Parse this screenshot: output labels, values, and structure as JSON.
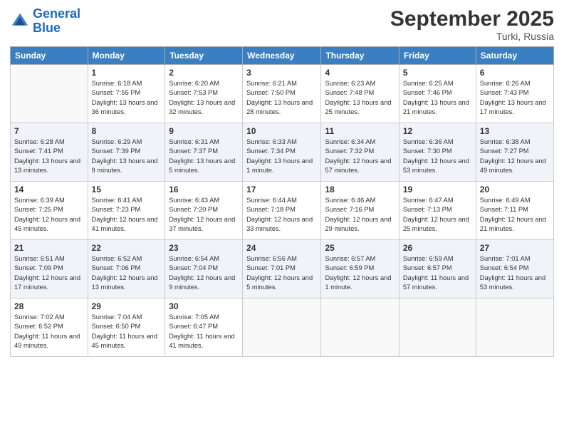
{
  "header": {
    "logo_line1": "General",
    "logo_line2": "Blue",
    "month": "September 2025",
    "location": "Turki, Russia"
  },
  "weekdays": [
    "Sunday",
    "Monday",
    "Tuesday",
    "Wednesday",
    "Thursday",
    "Friday",
    "Saturday"
  ],
  "weeks": [
    [
      {
        "day": "",
        "sunrise": "",
        "sunset": "",
        "daylight": ""
      },
      {
        "day": "1",
        "sunrise": "Sunrise: 6:18 AM",
        "sunset": "Sunset: 7:55 PM",
        "daylight": "Daylight: 13 hours and 36 minutes."
      },
      {
        "day": "2",
        "sunrise": "Sunrise: 6:20 AM",
        "sunset": "Sunset: 7:53 PM",
        "daylight": "Daylight: 13 hours and 32 minutes."
      },
      {
        "day": "3",
        "sunrise": "Sunrise: 6:21 AM",
        "sunset": "Sunset: 7:50 PM",
        "daylight": "Daylight: 13 hours and 28 minutes."
      },
      {
        "day": "4",
        "sunrise": "Sunrise: 6:23 AM",
        "sunset": "Sunset: 7:48 PM",
        "daylight": "Daylight: 13 hours and 25 minutes."
      },
      {
        "day": "5",
        "sunrise": "Sunrise: 6:25 AM",
        "sunset": "Sunset: 7:46 PM",
        "daylight": "Daylight: 13 hours and 21 minutes."
      },
      {
        "day": "6",
        "sunrise": "Sunrise: 6:26 AM",
        "sunset": "Sunset: 7:43 PM",
        "daylight": "Daylight: 13 hours and 17 minutes."
      }
    ],
    [
      {
        "day": "7",
        "sunrise": "Sunrise: 6:28 AM",
        "sunset": "Sunset: 7:41 PM",
        "daylight": "Daylight: 13 hours and 13 minutes."
      },
      {
        "day": "8",
        "sunrise": "Sunrise: 6:29 AM",
        "sunset": "Sunset: 7:39 PM",
        "daylight": "Daylight: 13 hours and 9 minutes."
      },
      {
        "day": "9",
        "sunrise": "Sunrise: 6:31 AM",
        "sunset": "Sunset: 7:37 PM",
        "daylight": "Daylight: 13 hours and 5 minutes."
      },
      {
        "day": "10",
        "sunrise": "Sunrise: 6:33 AM",
        "sunset": "Sunset: 7:34 PM",
        "daylight": "Daylight: 13 hours and 1 minute."
      },
      {
        "day": "11",
        "sunrise": "Sunrise: 6:34 AM",
        "sunset": "Sunset: 7:32 PM",
        "daylight": "Daylight: 12 hours and 57 minutes."
      },
      {
        "day": "12",
        "sunrise": "Sunrise: 6:36 AM",
        "sunset": "Sunset: 7:30 PM",
        "daylight": "Daylight: 12 hours and 53 minutes."
      },
      {
        "day": "13",
        "sunrise": "Sunrise: 6:38 AM",
        "sunset": "Sunset: 7:27 PM",
        "daylight": "Daylight: 12 hours and 49 minutes."
      }
    ],
    [
      {
        "day": "14",
        "sunrise": "Sunrise: 6:39 AM",
        "sunset": "Sunset: 7:25 PM",
        "daylight": "Daylight: 12 hours and 45 minutes."
      },
      {
        "day": "15",
        "sunrise": "Sunrise: 6:41 AM",
        "sunset": "Sunset: 7:23 PM",
        "daylight": "Daylight: 12 hours and 41 minutes."
      },
      {
        "day": "16",
        "sunrise": "Sunrise: 6:43 AM",
        "sunset": "Sunset: 7:20 PM",
        "daylight": "Daylight: 12 hours and 37 minutes."
      },
      {
        "day": "17",
        "sunrise": "Sunrise: 6:44 AM",
        "sunset": "Sunset: 7:18 PM",
        "daylight": "Daylight: 12 hours and 33 minutes."
      },
      {
        "day": "18",
        "sunrise": "Sunrise: 6:46 AM",
        "sunset": "Sunset: 7:16 PM",
        "daylight": "Daylight: 12 hours and 29 minutes."
      },
      {
        "day": "19",
        "sunrise": "Sunrise: 6:47 AM",
        "sunset": "Sunset: 7:13 PM",
        "daylight": "Daylight: 12 hours and 25 minutes."
      },
      {
        "day": "20",
        "sunrise": "Sunrise: 6:49 AM",
        "sunset": "Sunset: 7:11 PM",
        "daylight": "Daylight: 12 hours and 21 minutes."
      }
    ],
    [
      {
        "day": "21",
        "sunrise": "Sunrise: 6:51 AM",
        "sunset": "Sunset: 7:09 PM",
        "daylight": "Daylight: 12 hours and 17 minutes."
      },
      {
        "day": "22",
        "sunrise": "Sunrise: 6:52 AM",
        "sunset": "Sunset: 7:06 PM",
        "daylight": "Daylight: 12 hours and 13 minutes."
      },
      {
        "day": "23",
        "sunrise": "Sunrise: 6:54 AM",
        "sunset": "Sunset: 7:04 PM",
        "daylight": "Daylight: 12 hours and 9 minutes."
      },
      {
        "day": "24",
        "sunrise": "Sunrise: 6:56 AM",
        "sunset": "Sunset: 7:01 PM",
        "daylight": "Daylight: 12 hours and 5 minutes."
      },
      {
        "day": "25",
        "sunrise": "Sunrise: 6:57 AM",
        "sunset": "Sunset: 6:59 PM",
        "daylight": "Daylight: 12 hours and 1 minute."
      },
      {
        "day": "26",
        "sunrise": "Sunrise: 6:59 AM",
        "sunset": "Sunset: 6:57 PM",
        "daylight": "Daylight: 11 hours and 57 minutes."
      },
      {
        "day": "27",
        "sunrise": "Sunrise: 7:01 AM",
        "sunset": "Sunset: 6:54 PM",
        "daylight": "Daylight: 11 hours and 53 minutes."
      }
    ],
    [
      {
        "day": "28",
        "sunrise": "Sunrise: 7:02 AM",
        "sunset": "Sunset: 6:52 PM",
        "daylight": "Daylight: 11 hours and 49 minutes."
      },
      {
        "day": "29",
        "sunrise": "Sunrise: 7:04 AM",
        "sunset": "Sunset: 6:50 PM",
        "daylight": "Daylight: 11 hours and 45 minutes."
      },
      {
        "day": "30",
        "sunrise": "Sunrise: 7:05 AM",
        "sunset": "Sunset: 6:47 PM",
        "daylight": "Daylight: 11 hours and 41 minutes."
      },
      {
        "day": "",
        "sunrise": "",
        "sunset": "",
        "daylight": ""
      },
      {
        "day": "",
        "sunrise": "",
        "sunset": "",
        "daylight": ""
      },
      {
        "day": "",
        "sunrise": "",
        "sunset": "",
        "daylight": ""
      },
      {
        "day": "",
        "sunrise": "",
        "sunset": "",
        "daylight": ""
      }
    ]
  ]
}
